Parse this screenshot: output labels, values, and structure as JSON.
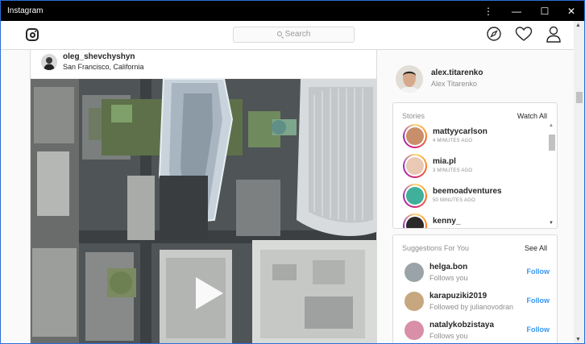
{
  "window": {
    "title": "Instagram",
    "controls": [
      "⋮",
      "—",
      "☐",
      "✕"
    ]
  },
  "header": {
    "search_placeholder": "Search",
    "icons": [
      "instagram-logo-icon",
      "search-icon",
      "compass-icon",
      "heart-icon",
      "profile-icon"
    ]
  },
  "post": {
    "username": "oleg_shevchyshyn",
    "location": "San Francisco, California"
  },
  "sidebar": {
    "me": {
      "username": "alex.titarenko",
      "full_name": "Alex Titarenko"
    },
    "stories": {
      "title": "Stories",
      "link": "Watch All",
      "items": [
        {
          "name": "mattyycarlson",
          "time": "4 MINUTES AGO"
        },
        {
          "name": "mia.pl",
          "time": "3 MINUTES AGO"
        },
        {
          "name": "beemoadventures",
          "time": "50 MINUTES AGO"
        },
        {
          "name": "kenny_",
          "time": ""
        }
      ]
    },
    "suggestions": {
      "title": "Suggestions For You",
      "link": "See All",
      "items": [
        {
          "name": "helga.bon",
          "sub": "Follows you",
          "action": "Follow"
        },
        {
          "name": "karapuziki2019",
          "sub": "Followed by julianovodran",
          "action": "Follow"
        },
        {
          "name": "natalykobzistaya",
          "sub": "Follows you",
          "action": "Follow"
        }
      ]
    }
  },
  "colors": {
    "accent": "#3897f0",
    "titlebar": "#000000",
    "border": "#dbdbdb"
  }
}
